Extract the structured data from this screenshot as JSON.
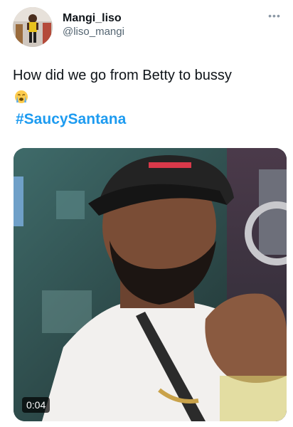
{
  "author": {
    "display_name": "Mangi_liso",
    "handle": "@liso_mangi"
  },
  "tweet": {
    "text": "How did we go from Betty to bussy",
    "emoji": "loudly-crying-face",
    "hashtag": "#SaucySantana"
  },
  "media": {
    "type": "video",
    "duration": "0:04"
  },
  "icons": {
    "more": "more-horizontal-icon"
  },
  "colors": {
    "hashtag": "#1d9bf0",
    "handle": "#536471",
    "text": "#0f1419"
  }
}
